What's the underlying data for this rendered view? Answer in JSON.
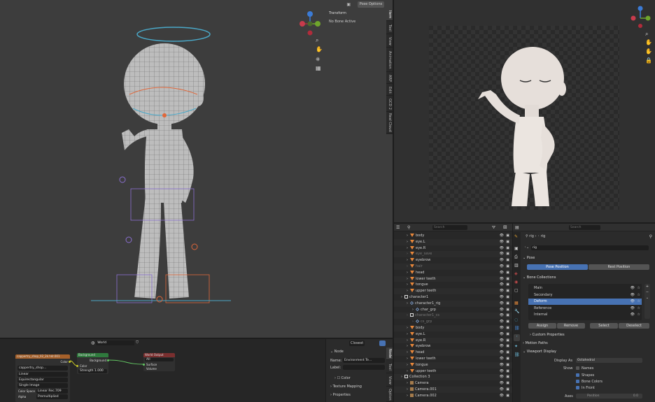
{
  "viewport3d": {
    "pose_options": "Pose Options",
    "transform_title": "Transform",
    "no_bone": "No Bone Active",
    "tabs": [
      "Item",
      "Tool",
      "View",
      "Animation",
      "ARP",
      "Edit",
      "GCD 2",
      "Real Cloud"
    ]
  },
  "node_editor": {
    "world_name": "World",
    "image_node": {
      "title": "cappertry_shop_02_2k.hdr.001",
      "out": "Color",
      "file": "cappertry_shop...",
      "interp": "Linear",
      "proj": "Equirectangular",
      "src": "Single Image",
      "cs_label": "Color Space",
      "cs": "Linear Rec.709",
      "alpha_label": "Alpha",
      "alpha": "Premultiplied"
    },
    "bg_node": {
      "title": "Background",
      "out": "Background",
      "color": "Color",
      "strength_label": "Strength",
      "strength": "1.000"
    },
    "out_node": {
      "title": "World Output",
      "target": "All",
      "surface": "Surface",
      "volume": "Volume"
    }
  },
  "node_sidebar": {
    "closest": "Closest",
    "node_title": "Node",
    "name_label": "Name:",
    "name_value": "Environment Te...",
    "label_label": "Label:",
    "color": "Color",
    "texture_mapping": "Texture Mapping",
    "properties": "Properties",
    "tabs": [
      "Node",
      "Tool",
      "View",
      "Option"
    ]
  },
  "outliner": {
    "search": "Search",
    "rows": [
      {
        "name": "body",
        "type": "mesh",
        "depth": 1
      },
      {
        "name": "eye.L",
        "type": "mesh",
        "depth": 1
      },
      {
        "name": "eye.R",
        "type": "mesh",
        "depth": 1
      },
      {
        "name": "eye_save",
        "type": "mesh",
        "depth": 1,
        "dim": true
      },
      {
        "name": "eyebrow",
        "type": "mesh",
        "depth": 1
      },
      {
        "name": "hair",
        "type": "mesh",
        "depth": 1,
        "dim": true
      },
      {
        "name": "head",
        "type": "mesh",
        "depth": 1
      },
      {
        "name": "lower teeth",
        "type": "mesh",
        "depth": 1
      },
      {
        "name": "tongue",
        "type": "mesh",
        "depth": 1
      },
      {
        "name": "upper teeth",
        "type": "mesh",
        "depth": 1
      },
      {
        "name": "character1",
        "type": "collection",
        "depth": 0
      },
      {
        "name": "character1_rig",
        "type": "armature",
        "depth": 1
      },
      {
        "name": "char_grp",
        "type": "armature",
        "depth": 2
      },
      {
        "name": "character1_cs",
        "type": "collection",
        "depth": 1,
        "dim": true
      },
      {
        "name": "cs_grp",
        "type": "armature",
        "depth": 2,
        "dim": true
      },
      {
        "name": "body",
        "type": "mesh",
        "depth": 1
      },
      {
        "name": "eye.L",
        "type": "mesh",
        "depth": 1
      },
      {
        "name": "eye.R",
        "type": "mesh",
        "depth": 1
      },
      {
        "name": "eyebrow",
        "type": "mesh",
        "depth": 1
      },
      {
        "name": "head",
        "type": "mesh",
        "depth": 1
      },
      {
        "name": "lower teeth",
        "type": "mesh",
        "depth": 1
      },
      {
        "name": "tongue",
        "type": "mesh",
        "depth": 1
      },
      {
        "name": "upper teeth",
        "type": "mesh",
        "depth": 1
      },
      {
        "name": "Collection 3",
        "type": "collection",
        "depth": 0
      },
      {
        "name": "Camera",
        "type": "camera",
        "depth": 1
      },
      {
        "name": "Camera.001",
        "type": "camera",
        "depth": 1
      },
      {
        "name": "Camera.002",
        "type": "camera",
        "depth": 1
      }
    ]
  },
  "properties": {
    "search": "Search",
    "breadcrumb_a": "rig",
    "breadcrumb_b": "rig",
    "data_name": "rig",
    "pose_section": "Pose",
    "pose_position": "Pose Position",
    "rest_position": "Rest Position",
    "bone_collections": "Bone Collections",
    "collections": [
      {
        "name": "Main",
        "selected": false
      },
      {
        "name": "Secondary",
        "selected": false
      },
      {
        "name": "Deform",
        "selected": true
      },
      {
        "name": "Reference",
        "selected": false
      },
      {
        "name": "Internal",
        "selected": false
      }
    ],
    "assign": "Assign",
    "remove": "Remove",
    "select": "Select",
    "deselect": "Deselect",
    "custom_props": "Custom Properties",
    "motion_paths": "Motion Paths",
    "viewport_display": "Viewport Display",
    "display_as_label": "Display As",
    "display_as": "Octahedral",
    "show_label": "Show",
    "names": "Names",
    "shapes": "Shapes",
    "bone_colors": "Bone Colors",
    "in_front": "In Front",
    "axes": "Axes",
    "axes_value": "Position",
    "axes_num": "0.0"
  },
  "colors": {
    "accent": "#4772b3",
    "mesh": "#e8873a",
    "armature": "#7fb0e6"
  }
}
